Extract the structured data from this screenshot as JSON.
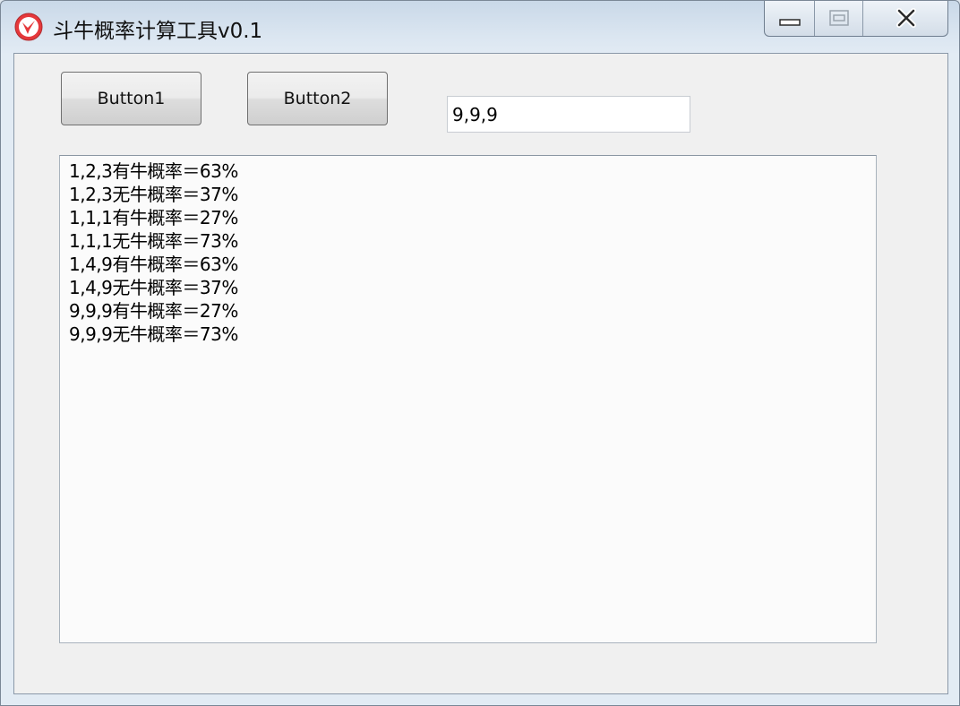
{
  "window": {
    "title": "斗牛概率计算工具v0.1",
    "icon": "app-logo-icon",
    "accent_color": "#e5383b"
  },
  "caption": {
    "minimize_icon": "minimize-icon",
    "maximize_icon": "maximize-icon",
    "close_icon": "close-icon"
  },
  "toolbar": {
    "button1_label": "Button1",
    "button2_label": "Button2"
  },
  "input": {
    "value": "9,9,9"
  },
  "output": {
    "lines": [
      "1,2,3有牛概率＝63%",
      "1,2,3无牛概率＝37%",
      "1,1,1有牛概率＝27%",
      "1,1,1无牛概率＝73%",
      "1,4,9有牛概率＝63%",
      "1,4,9无牛概率＝37%",
      "9,9,9有牛概率＝27%",
      "9,9,9无牛概率＝73%"
    ]
  }
}
